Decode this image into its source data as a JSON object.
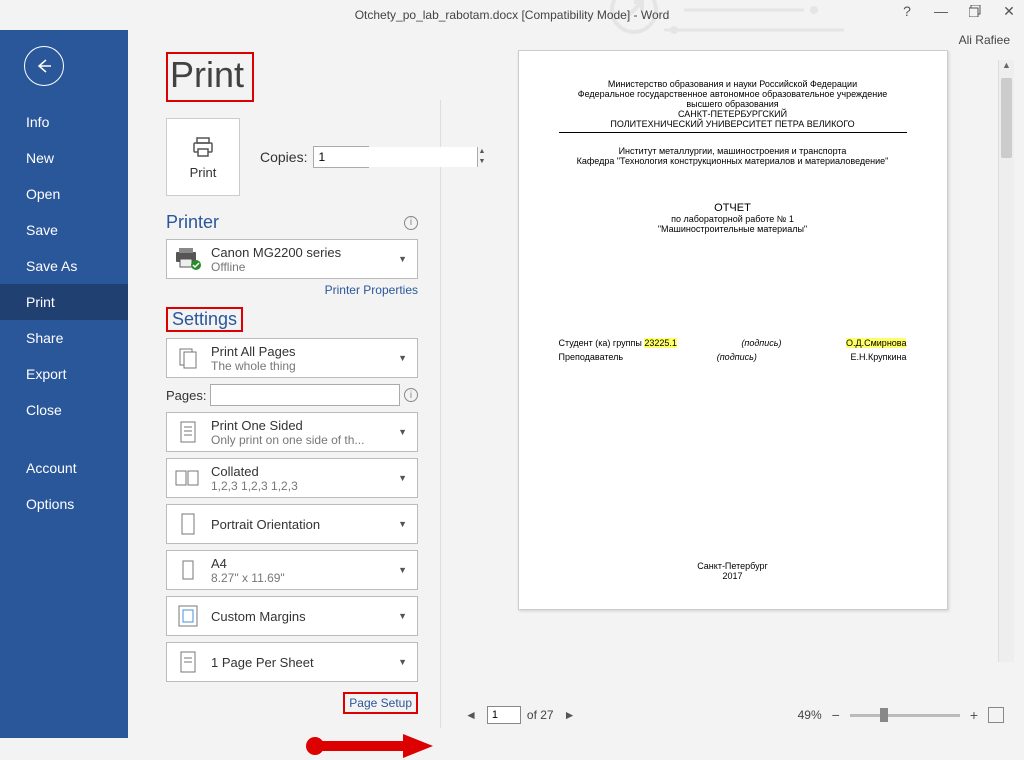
{
  "titlebar": {
    "title": "Otchety_po_lab_rabotam.docx [Compatibility Mode] - Word",
    "username": "Ali Rafiee"
  },
  "sidebar": {
    "items": [
      {
        "label": "Info"
      },
      {
        "label": "New"
      },
      {
        "label": "Open"
      },
      {
        "label": "Save"
      },
      {
        "label": "Save As"
      },
      {
        "label": "Print"
      },
      {
        "label": "Share"
      },
      {
        "label": "Export"
      },
      {
        "label": "Close"
      },
      {
        "label": "Account"
      },
      {
        "label": "Options"
      }
    ]
  },
  "print": {
    "title": "Print",
    "button_label": "Print",
    "copies_label": "Copies:",
    "copies_value": "1"
  },
  "printer": {
    "heading": "Printer",
    "name": "Canon MG2200 series",
    "status": "Offline",
    "props_link": "Printer Properties"
  },
  "settings": {
    "heading": "Settings",
    "print_all": {
      "title": "Print All Pages",
      "sub": "The whole thing"
    },
    "pages_label": "Pages:",
    "pages_value": "",
    "sides": {
      "title": "Print One Sided",
      "sub": "Only print on one side of th..."
    },
    "collate": {
      "title": "Collated",
      "sub": "1,2,3    1,2,3    1,2,3"
    },
    "orient": {
      "title": "Portrait Orientation",
      "sub": ""
    },
    "paper": {
      "title": "A4",
      "sub": "8.27\" x 11.69\""
    },
    "margins": {
      "title": "Custom Margins",
      "sub": ""
    },
    "sheet": {
      "title": "1 Page Per Sheet",
      "sub": ""
    },
    "page_setup_link": "Page Setup"
  },
  "preview": {
    "current_page": "1",
    "page_of_label": "of 27",
    "zoom_label": "49%",
    "doc": {
      "l1": "Министерство образования и науки Российской Федерации",
      "l2": "Федеральное государственное автономное образовательное учреждение",
      "l3": "высшего образования",
      "l4": "САНКТ-ПЕТЕРБУРГСКИЙ",
      "l5": "ПОЛИТЕХНИЧЕСКИЙ УНИВЕРСИТЕТ ПЕТРА ВЕЛИКОГО",
      "l6": "Институт металлургии, машиностроения и транспорта",
      "l7": "Кафедра \"Технология конструкционных материалов и материаловедение\"",
      "report": "ОТЧЕТ",
      "lab": "по лабораторной работе № 1",
      "topic": "\"Машиностроительные материалы\"",
      "row1a": "Студент (ка) группы",
      "row1a_hl": "23225.1",
      "row1b": "(подпись)",
      "row1c": "О.Д.Смирнова",
      "row2a": "Преподаватель",
      "row2b": "(подпись)",
      "row2c": "Е.Н.Крупкина",
      "city": "Санкт-Петербург",
      "year": "2017"
    }
  }
}
